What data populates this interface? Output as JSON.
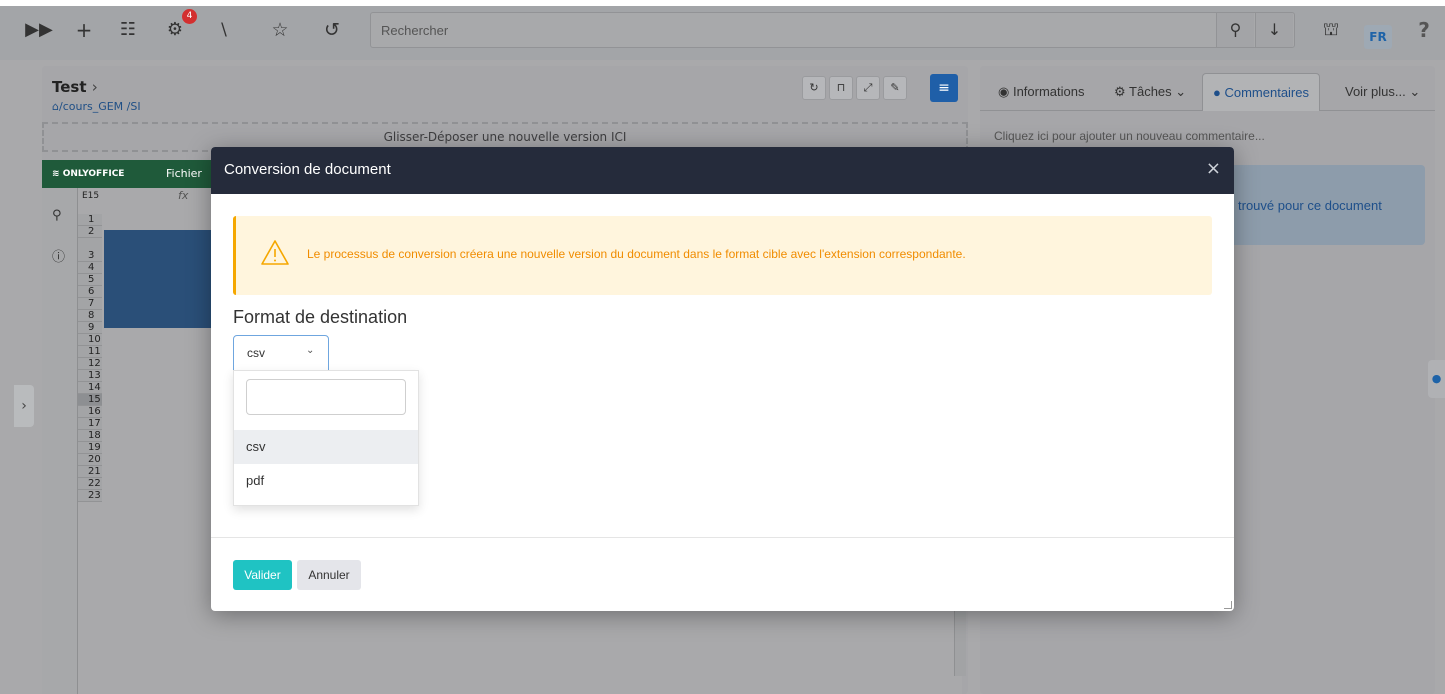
{
  "toolbar": {
    "notifications_count": "4",
    "search_placeholder": "Rechercher",
    "language": "FR",
    "help": "?"
  },
  "document": {
    "title": "Test",
    "path_root": "/cours_GEM",
    "path_sub": "/SI",
    "drop_zone": "Glisser-Déposer une nouvelle version ICI"
  },
  "editor": {
    "logo": "ONLYOFFICE",
    "menu_file": "Fichier",
    "cell_ref": "E15",
    "fx": "fx",
    "row_numbers": [
      "1",
      "2",
      "3",
      "4",
      "5",
      "6",
      "7",
      "8",
      "9",
      "10",
      "11",
      "12",
      "13",
      "14",
      "15",
      "16",
      "17",
      "18",
      "19",
      "20",
      "21",
      "22",
      "23"
    ]
  },
  "right_panel": {
    "tabs": [
      {
        "label": "Informations"
      },
      {
        "label": "Tâches"
      },
      {
        "label": "Commentaires"
      },
      {
        "label": "Voir plus..."
      }
    ],
    "add_comment": "Cliquez ici pour ajouter un nouveau commentaire...",
    "empty_info": "trouvé pour ce document"
  },
  "modal": {
    "title": "Conversion de document",
    "close": "×",
    "alert": "Le processus de conversion créera une nouvelle version du document dans le format cible avec l'extension correspondante.",
    "format_label": "Format de destination",
    "selected": "csv",
    "options": [
      "csv",
      "pdf"
    ],
    "validate": "Valider",
    "cancel": "Annuler"
  },
  "colors": {
    "accent": "#1fc3c3",
    "warning": "#f08c00",
    "header": "#252b3b"
  }
}
